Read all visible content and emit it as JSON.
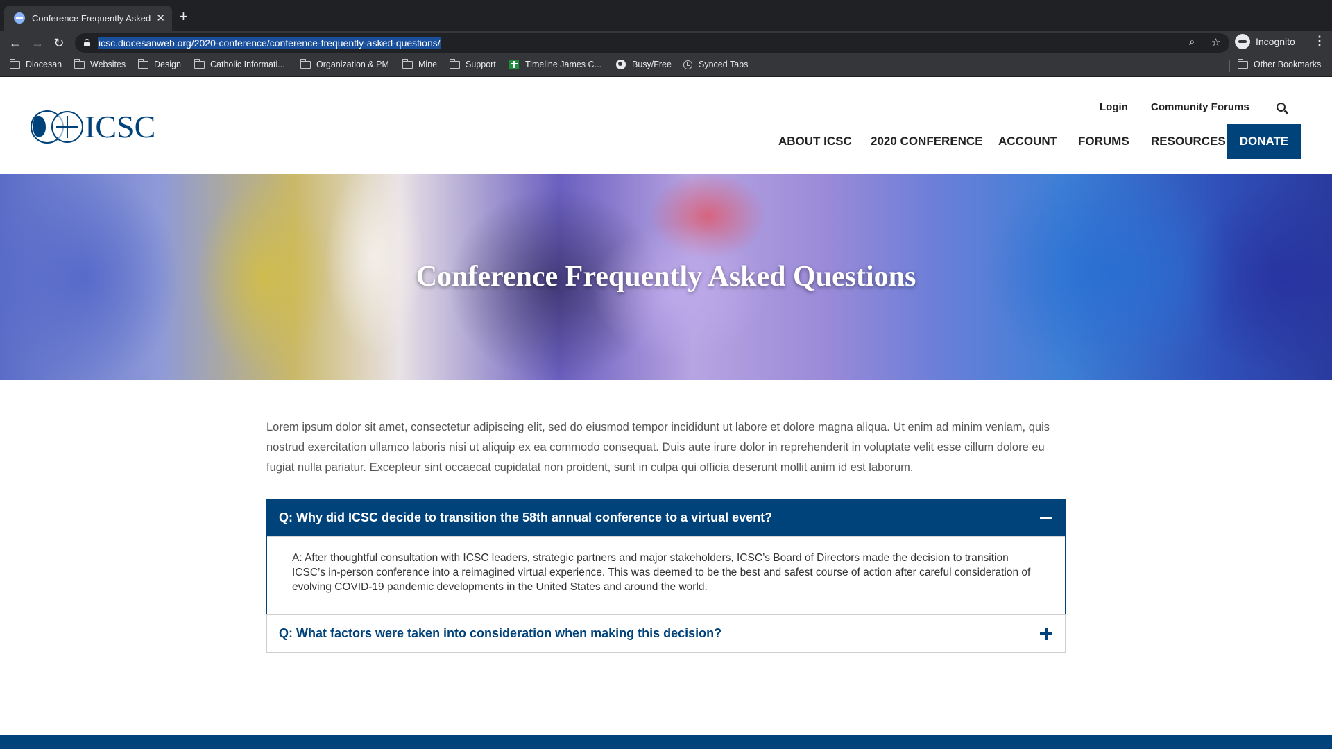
{
  "browser": {
    "tab": {
      "title": "Conference Frequently Asked Questions"
    },
    "url": "icsc.diocesanweb.org/2020-conference/conference-frequently-asked-questions/",
    "profile_label": "Incognito",
    "bookmarks": [
      {
        "label": "Diocesan",
        "icon": "folder"
      },
      {
        "label": "Websites",
        "icon": "folder"
      },
      {
        "label": "Design",
        "icon": "folder"
      },
      {
        "label": "Catholic Informati...",
        "icon": "folder"
      },
      {
        "label": "Organization & PM",
        "icon": "folder"
      },
      {
        "label": "Mine",
        "icon": "folder"
      },
      {
        "label": "Support",
        "icon": "folder"
      },
      {
        "label": "Timeline James C...",
        "icon": "green-cross"
      },
      {
        "label": "Busy/Free",
        "icon": "globe"
      },
      {
        "label": "Synced Tabs",
        "icon": "history"
      }
    ],
    "other_bookmarks": "Other Bookmarks"
  },
  "site": {
    "logo_text": "ICSC",
    "utility_nav": {
      "login": "Login",
      "forums": "Community Forums"
    },
    "main_nav": {
      "about": "ABOUT ICSC",
      "conference": "2020 CONFERENCE",
      "account": "ACCOUNT",
      "forums": "FORUMS",
      "resources": "RESOURCES",
      "donate": "DONATE"
    },
    "brand_color": "#00427a"
  },
  "hero": {
    "title": "Conference Frequently Asked Questions"
  },
  "content": {
    "intro": "Lorem ipsum dolor sit amet, consectetur adipiscing elit, sed do eiusmod tempor incididunt ut labore et dolore magna aliqua. Ut enim ad minim veniam, quis nostrud exercitation ullamco laboris nisi ut aliquip ex ea commodo consequat. Duis aute irure dolor in reprehenderit in voluptate velit esse cillum dolore eu fugiat nulla pariatur. Excepteur sint occaecat cupidatat non proident, sunt in culpa qui officia deserunt mollit anim id est laborum.",
    "faqs": [
      {
        "question": "Q: Why did ICSC decide to transition the 58th annual conference to a virtual event?",
        "answer": "A: After thoughtful consultation with ICSC leaders, strategic partners and major stakeholders, ICSC’s Board of Directors made the decision to transition ICSC’s in-person conference into a reimagined virtual experience. This was deemed to be the best and safest course of action after careful consideration of evolving COVID-19 pandemic developments in the United States and around the world.",
        "expanded": true
      },
      {
        "question": "Q: What factors were taken into consideration when making this decision?",
        "expanded": false
      }
    ]
  }
}
